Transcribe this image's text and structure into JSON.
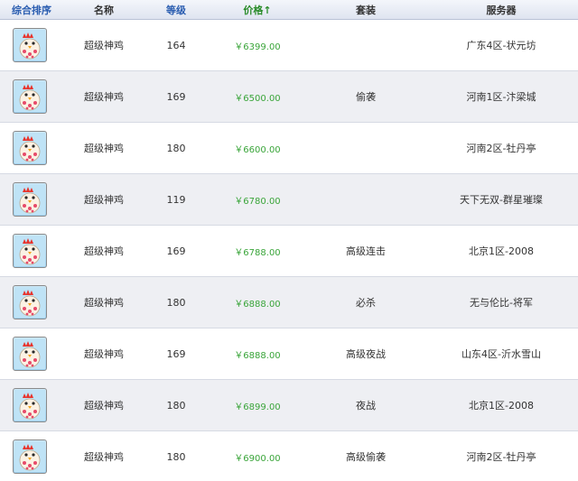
{
  "header": {
    "sort": "综合排序",
    "name": "名称",
    "level": "等级",
    "price": "价格↑",
    "suit": "套装",
    "server": "服务器"
  },
  "icon": "chicken-pet-icon",
  "rows": [
    {
      "name": "超级神鸡",
      "level": "164",
      "price": "￥6399.00",
      "suit": "",
      "server": "广东4区-状元坊"
    },
    {
      "name": "超级神鸡",
      "level": "169",
      "price": "￥6500.00",
      "suit": "偷袭",
      "server": "河南1区-汴梁城"
    },
    {
      "name": "超级神鸡",
      "level": "180",
      "price": "￥6600.00",
      "suit": "",
      "server": "河南2区-牡丹亭"
    },
    {
      "name": "超级神鸡",
      "level": "119",
      "price": "￥6780.00",
      "suit": "",
      "server": "天下无双-群星璀璨"
    },
    {
      "name": "超级神鸡",
      "level": "169",
      "price": "￥6788.00",
      "suit": "高级连击",
      "server": "北京1区-2008"
    },
    {
      "name": "超级神鸡",
      "level": "180",
      "price": "￥6888.00",
      "suit": "必杀",
      "server": "无与伦比-将军"
    },
    {
      "name": "超级神鸡",
      "level": "169",
      "price": "￥6888.00",
      "suit": "高级夜战",
      "server": "山东4区-沂水雪山"
    },
    {
      "name": "超级神鸡",
      "level": "180",
      "price": "￥6899.00",
      "suit": "夜战",
      "server": "北京1区-2008"
    },
    {
      "name": "超级神鸡",
      "level": "180",
      "price": "￥6900.00",
      "suit": "高级偷袭",
      "server": "河南2区-牡丹亭"
    }
  ]
}
